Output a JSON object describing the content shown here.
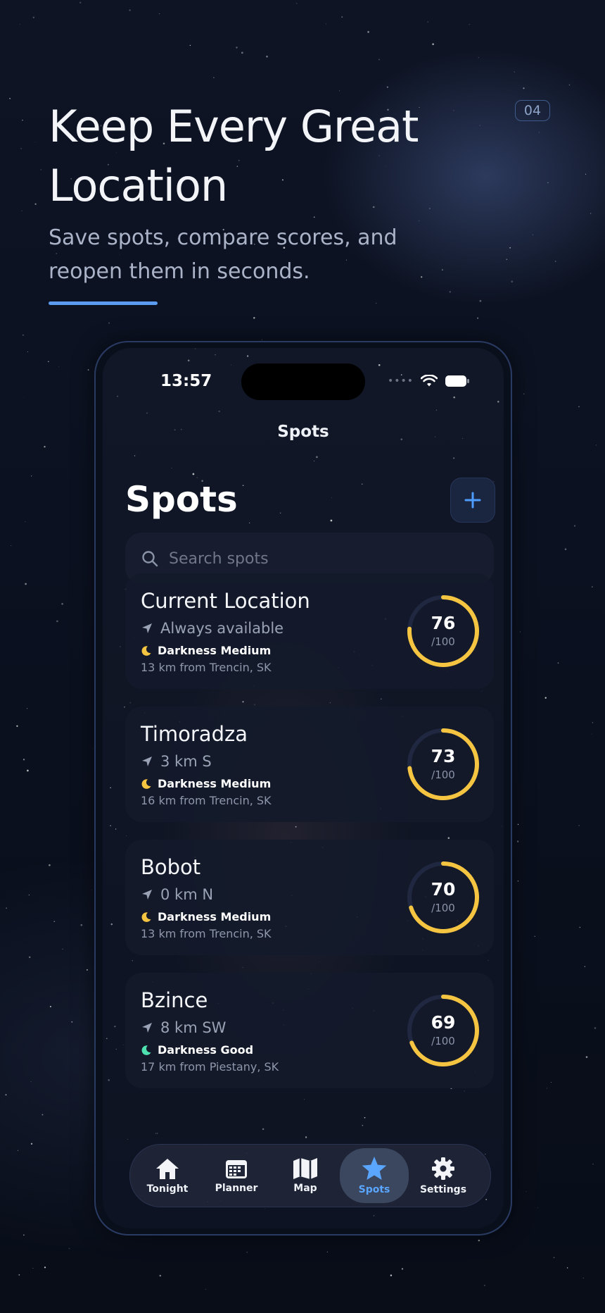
{
  "hero": {
    "headline": "Keep Every Great Location",
    "subheadline": "Save spots, compare scores, and reopen them in seconds.",
    "page_number": "04"
  },
  "status_bar": {
    "time": "13:57"
  },
  "nav": {
    "title": "Spots"
  },
  "header": {
    "large_title": "Spots"
  },
  "search": {
    "placeholder": "Search spots"
  },
  "spots": [
    {
      "name": "Current Location",
      "direction": "Always available",
      "darkness": "Darkness Medium",
      "location": "13 km from Trencin, SK",
      "score": "76",
      "score_max": "/100",
      "score_fraction": 0.76,
      "moon_color": "#f5c542"
    },
    {
      "name": "Timoradza",
      "direction": "3 km S",
      "darkness": "Darkness Medium",
      "location": "16 km from Trencin, SK",
      "score": "73",
      "score_max": "/100",
      "score_fraction": 0.73,
      "moon_color": "#f5c542"
    },
    {
      "name": "Bobot",
      "direction": "0 km N",
      "darkness": "Darkness Medium",
      "location": "13 km from Trencin, SK",
      "score": "70",
      "score_max": "/100",
      "score_fraction": 0.7,
      "moon_color": "#f5c542"
    },
    {
      "name": "Bzince",
      "direction": "8 km SW",
      "darkness": "Darkness Good",
      "location": "17 km from Piestany, SK",
      "score": "69",
      "score_max": "/100",
      "score_fraction": 0.69,
      "moon_color": "#4fe0b0"
    }
  ],
  "tabs": [
    {
      "label": "Tonight",
      "icon": "house-icon",
      "active": false
    },
    {
      "label": "Planner",
      "icon": "calendar-icon",
      "active": false
    },
    {
      "label": "Map",
      "icon": "map-icon",
      "active": false
    },
    {
      "label": "Spots",
      "icon": "star-icon",
      "active": true
    },
    {
      "label": "Settings",
      "icon": "gear-icon",
      "active": false
    }
  ],
  "colors": {
    "accent": "#5aa6ff",
    "score_ring": "#f5c542",
    "underline": "#5b9cf0"
  }
}
